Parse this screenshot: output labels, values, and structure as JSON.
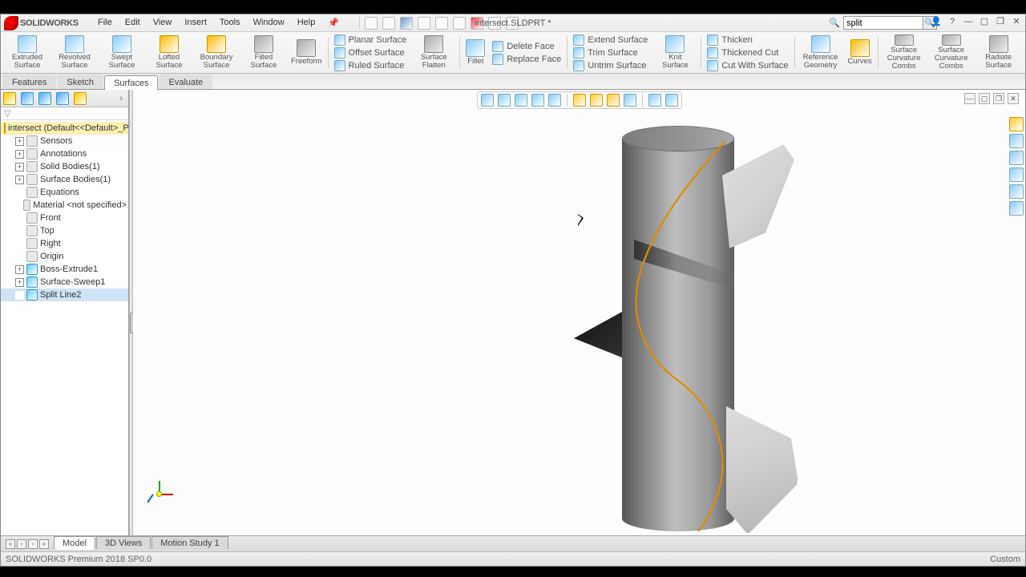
{
  "app_name": "SOLIDWORKS",
  "document": "intersect.SLDPRT *",
  "search": {
    "value": "split"
  },
  "menus": [
    "File",
    "Edit",
    "View",
    "Insert",
    "Tools",
    "Window",
    "Help"
  ],
  "ribbon_big": [
    {
      "label": "Extruded Surface"
    },
    {
      "label": "Revolved Surface"
    },
    {
      "label": "Swept Surface"
    },
    {
      "label": "Lofted Surface"
    },
    {
      "label": "Boundary Surface"
    },
    {
      "label": "Filled Surface"
    },
    {
      "label": "Freeform"
    }
  ],
  "ribbon_col1": [
    {
      "label": "Planar Surface"
    },
    {
      "label": "Offset Surface"
    },
    {
      "label": "Ruled Surface"
    }
  ],
  "ribbon_mid": [
    {
      "label": "Surface Flatten"
    },
    {
      "label": "Fillet"
    }
  ],
  "ribbon_col2": [
    {
      "label": "Delete Face"
    },
    {
      "label": "Replace Face"
    }
  ],
  "ribbon_col3": [
    {
      "label": "Extend Surface"
    },
    {
      "label": "Trim Surface"
    },
    {
      "label": "Untrim Surface"
    }
  ],
  "ribbon_mid2": [
    {
      "label": "Knit Surface"
    }
  ],
  "ribbon_col4": [
    {
      "label": "Thicken"
    },
    {
      "label": "Thickened Cut"
    },
    {
      "label": "Cut With Surface"
    }
  ],
  "ribbon_end": [
    {
      "label": "Reference Geometry"
    },
    {
      "label": "Curves"
    },
    {
      "label": "Surface Curvature Combs"
    },
    {
      "label": "Surface Curvature Combs"
    },
    {
      "label": "Radiate Surface"
    }
  ],
  "tabs": [
    "Features",
    "Sketch",
    "Surfaces",
    "Evaluate"
  ],
  "active_tab": "Surfaces",
  "tree_root": "intersect (Default<<Default>_PhotoWor",
  "tree": [
    {
      "label": "Sensors",
      "exp": "+"
    },
    {
      "label": "Annotations",
      "exp": "+"
    },
    {
      "label": "Solid Bodies(1)",
      "exp": "+"
    },
    {
      "label": "Surface Bodies(1)",
      "exp": "+"
    },
    {
      "label": "Equations",
      "exp": ""
    },
    {
      "label": "Material <not specified>",
      "exp": ""
    },
    {
      "label": "Front",
      "exp": ""
    },
    {
      "label": "Top",
      "exp": ""
    },
    {
      "label": "Right",
      "exp": ""
    },
    {
      "label": "Origin",
      "exp": ""
    },
    {
      "label": "Boss-Extrude1",
      "exp": "+"
    },
    {
      "label": "Surface-Sweep1",
      "exp": "+"
    },
    {
      "label": "Split Line2",
      "exp": "",
      "sel": true
    }
  ],
  "bottom_tabs": [
    "Model",
    "3D Views",
    "Motion Study 1"
  ],
  "active_btab": "Model",
  "status_left": "SOLIDWORKS Premium 2018 SP0.0",
  "status_right": "Custom"
}
